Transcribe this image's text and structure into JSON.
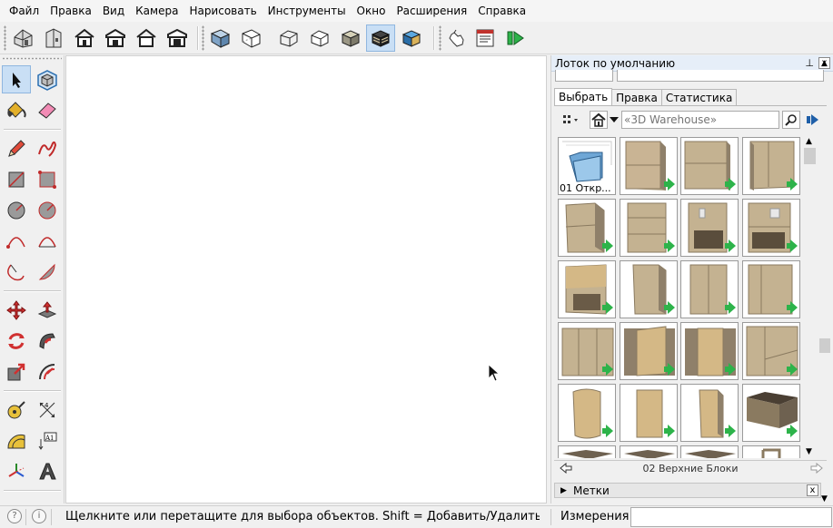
{
  "menu": [
    "Файл",
    "Правка",
    "Вид",
    "Камера",
    "Нарисовать",
    "Инструменты",
    "Окно",
    "Расширения",
    "Справка"
  ],
  "toolbar": {
    "buttons": [
      "house-shaded-icon",
      "house-side-icon",
      "house-front-icon",
      "house-iso-icon",
      "house-outline-icon",
      "house-back-icon",
      "cube-shaded-icon",
      "cube-wire-icon",
      "cube-xray-icon",
      "cube-hidden-icon",
      "cube-textured-icon",
      "cube-monochrome-icon",
      "cube-sky-icon",
      "hand-grab-icon",
      "model-info-icon",
      "extension-run-icon"
    ],
    "active": "cube-monochrome-icon"
  },
  "palette": {
    "tools": [
      "select-arrow-icon",
      "make-component-icon",
      "paint-bucket-icon",
      "eraser-icon",
      "pencil-line-icon",
      "freehand-icon",
      "rectangle-icon",
      "rotated-rectangle-icon",
      "circle-icon",
      "polygon-icon",
      "arc-icon",
      "two-point-arc-icon",
      "three-point-arc-icon",
      "pie-icon",
      "move-icon",
      "push-pull-icon",
      "rotate-icon",
      "follow-me-icon",
      "scale-icon",
      "offset-icon",
      "tape-measure-icon",
      "dimension-icon",
      "protractor-icon",
      "text-label-icon",
      "axes-icon",
      "3d-text-icon"
    ],
    "active": "select-arrow-icon"
  },
  "tray": {
    "title": "Лоток по умолчанию",
    "pin": "⊥",
    "close": "x",
    "tabs": [
      "Выбрать",
      "Правка",
      "Статистика"
    ],
    "active_tab": "Выбрать",
    "search_placeholder": "«3D Warehouse»",
    "first_item_label": "01 Откр...",
    "collection_name": "02 Верхние Блоки",
    "labels_panel": "Метки"
  },
  "status": {
    "message": "Щелкните или перетащите для выбора объектов. Shift = Добавить/Удалить. Ctrl = Д...",
    "measurements_label": "Измерения",
    "measurements_value": "",
    "info_icon": "i"
  },
  "colors": {
    "selection": "#c9dff5",
    "cabinet_wood": "#b6a589",
    "cabinet_door": "#d4b886",
    "arrow_green": "#2db34a"
  }
}
